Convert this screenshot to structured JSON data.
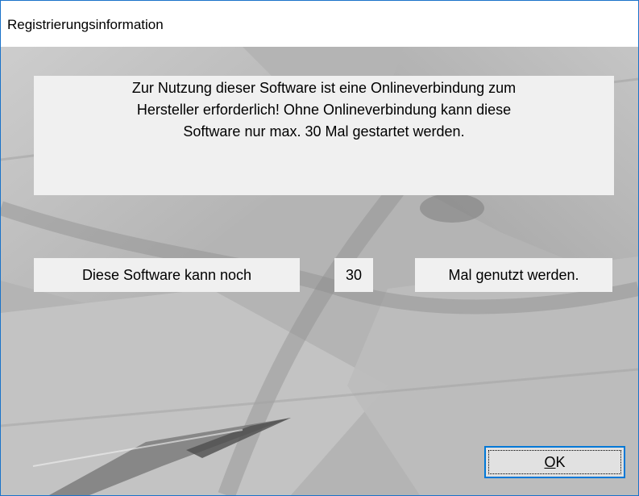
{
  "window": {
    "title": "Registrierungsinformation"
  },
  "info": {
    "line1": "Zur Nutzung dieser Software ist eine Onlineverbindung zum",
    "line2": "Hersteller erforderlich! Ohne Onlineverbindung kann diese",
    "line3": "Software nur max. 30 Mal gestartet werden."
  },
  "usage": {
    "prefix_label": "Diese Software kann noch",
    "remaining_count": "30",
    "suffix_label": "Mal genutzt werden."
  },
  "ok_button": {
    "mnemonic": "O",
    "rest": "K"
  },
  "colors": {
    "window_border": "#1a73c9",
    "focus_border": "#0078d7",
    "panel_background": "#f0f0f0",
    "button_face": "#e1e1e1"
  },
  "icons": {
    "background": "pen-and-paper-background-image"
  }
}
